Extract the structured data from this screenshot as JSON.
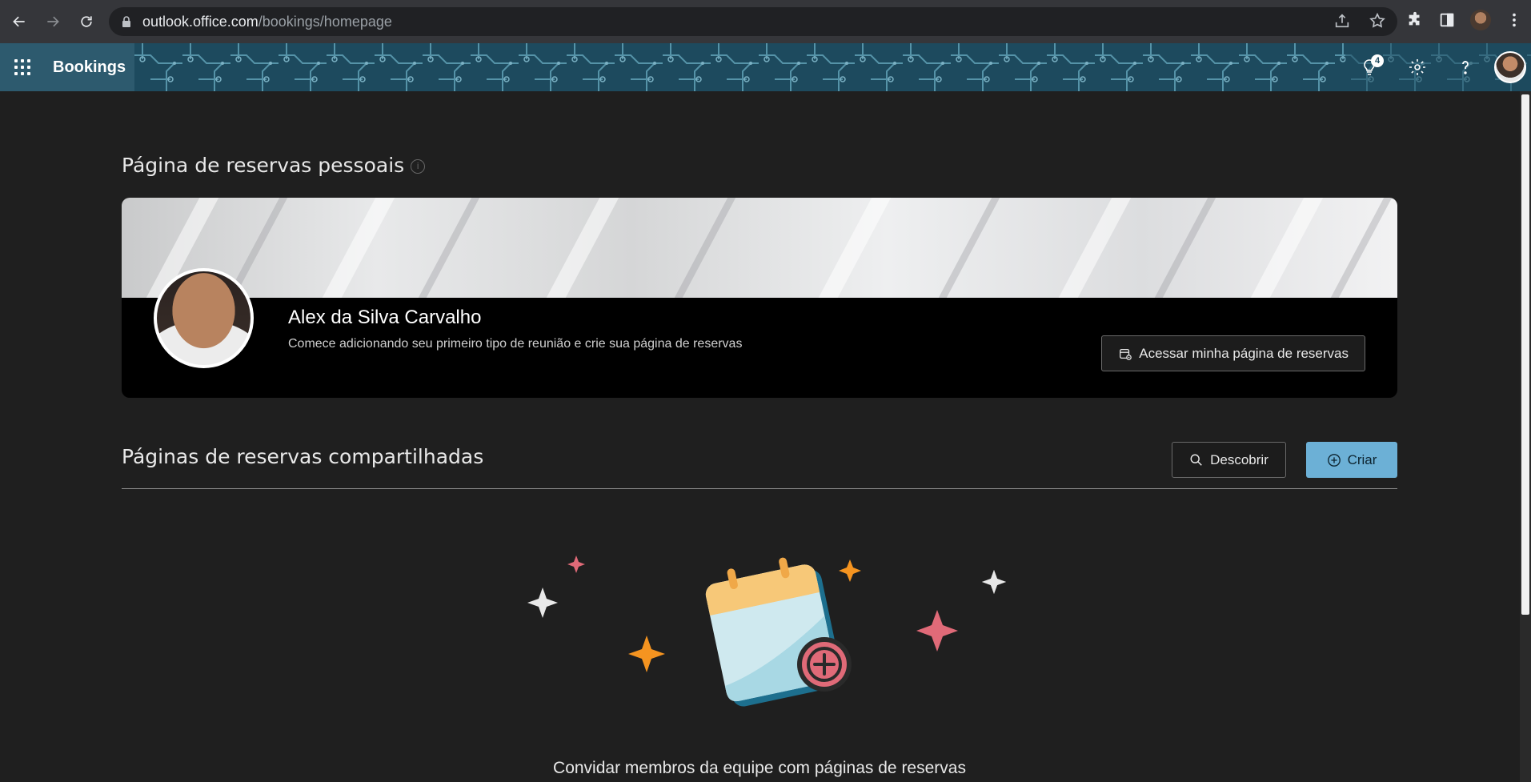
{
  "browser": {
    "url_host": "outlook.office.com",
    "url_path": "/bookings/homepage"
  },
  "appbar": {
    "app_name": "Bookings",
    "tips_badge": "4"
  },
  "personal": {
    "section_title": "Página de reservas pessoais",
    "name": "Alex da Silva Carvalho",
    "subtitle": "Comece adicionando seu primeiro tipo de reunião e crie sua página de reservas",
    "access_button": "Acessar minha página de reservas"
  },
  "shared": {
    "section_title": "Páginas de reservas compartilhadas",
    "discover_button": "Descobrir",
    "create_button": "Criar",
    "empty_state_text": "Convidar membros da equipe com páginas de reservas"
  },
  "icons": {
    "back": "arrow-left-icon",
    "forward": "arrow-right-icon",
    "reload": "reload-icon",
    "lock": "lock-icon",
    "share": "share-icon",
    "star": "star-icon",
    "extensions": "puzzle-icon",
    "sidepanel": "sidepanel-icon",
    "menu": "kebab-icon",
    "tips": "lightbulb-icon",
    "settings": "gear-icon",
    "help": "question-icon"
  },
  "colors": {
    "accent": "#6cb0d6",
    "appbar": "#1e4a5e",
    "background": "#1f1f1f"
  }
}
